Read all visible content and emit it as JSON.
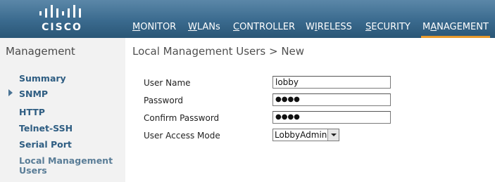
{
  "brand": {
    "logo_text": "CISCO"
  },
  "nav": {
    "items": [
      {
        "mnemonic": "M",
        "rest": "ONITOR"
      },
      {
        "mnemonic": "W",
        "rest": "LANs"
      },
      {
        "mnemonic": "C",
        "rest": "ONTROLLER"
      },
      {
        "pre": "W",
        "mnemonic": "I",
        "rest": "RELESS"
      },
      {
        "mnemonic": "S",
        "rest": "ECURITY"
      },
      {
        "pre": "M",
        "mnemonic": "A",
        "rest": "NAGEMENT"
      }
    ],
    "active": "MANAGEMENT",
    "active_color": "#e89a2c"
  },
  "sidebar": {
    "title": "Management",
    "items": [
      {
        "label": "Summary"
      },
      {
        "label": "SNMP"
      },
      {
        "label": "HTTP"
      },
      {
        "label": "Telnet-SSH"
      },
      {
        "label": "Serial Port"
      },
      {
        "label": "Local Management"
      },
      {
        "label": "Users"
      }
    ]
  },
  "page": {
    "title": "Local Management Users > New"
  },
  "form": {
    "user_name": {
      "label": "User Name",
      "value": "lobby"
    },
    "password": {
      "label": "Password",
      "value": "●●●●"
    },
    "confirm_password": {
      "label": "Confirm Password",
      "value": "●●●●"
    },
    "access_mode": {
      "label": "User Access Mode",
      "value": "LobbyAdmin"
    }
  }
}
